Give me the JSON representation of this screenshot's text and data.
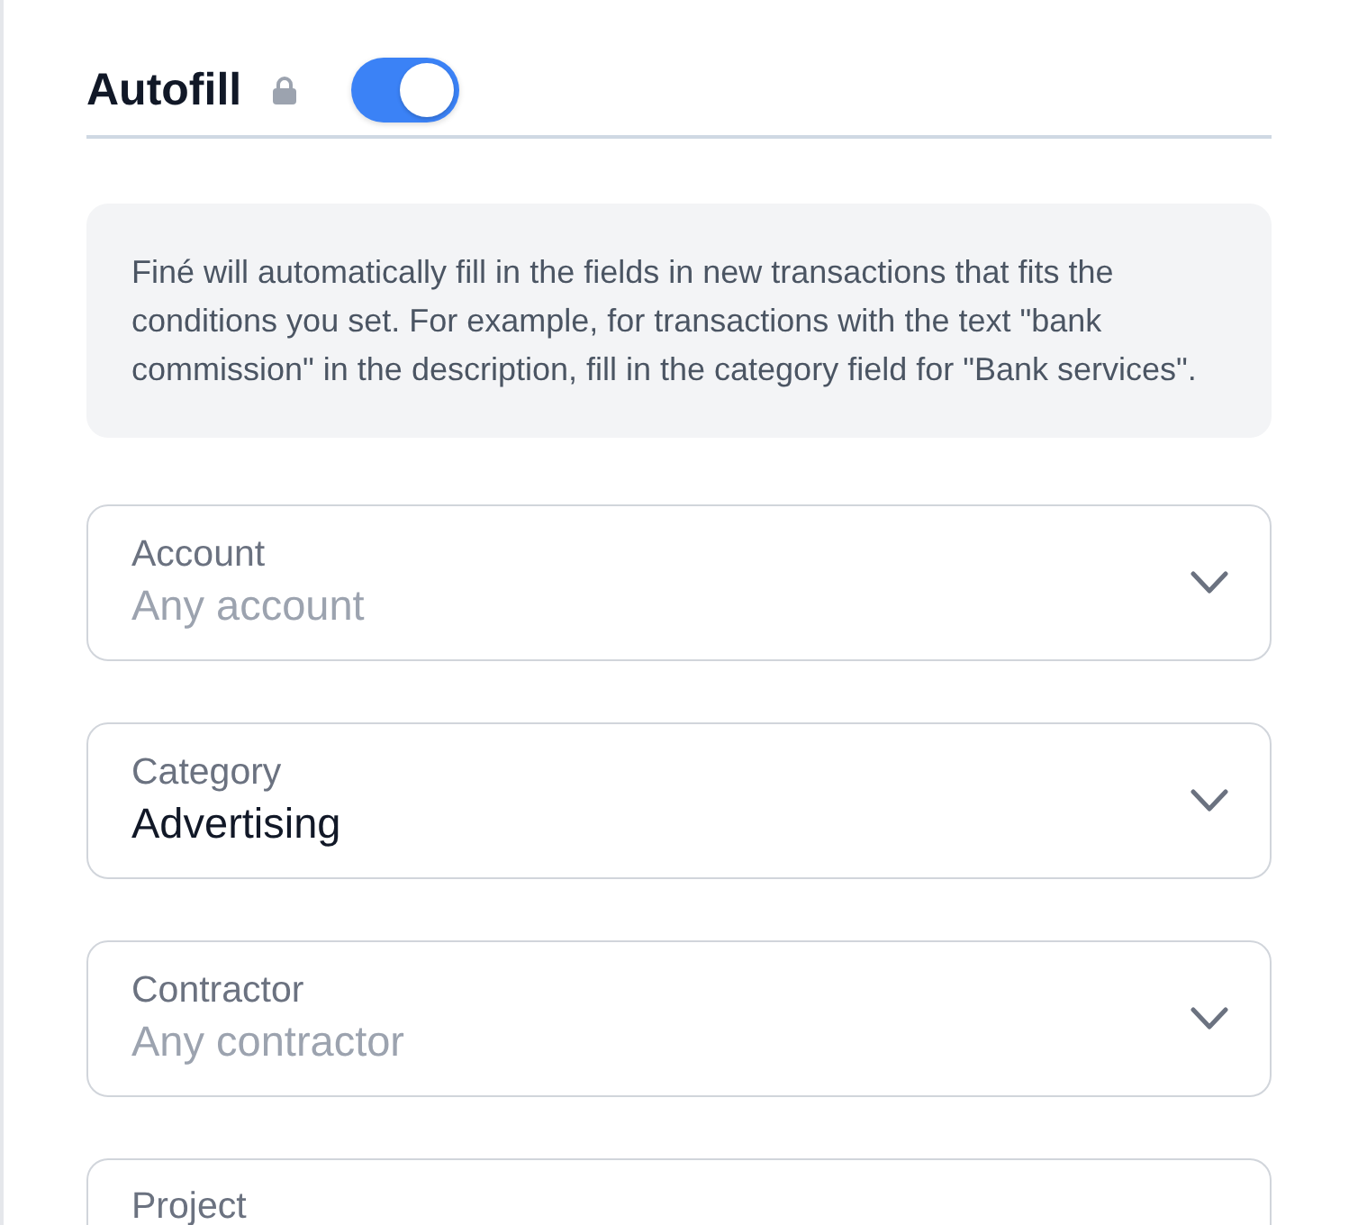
{
  "header": {
    "title": "Autofill",
    "toggle": {
      "on": true
    }
  },
  "info": {
    "text": "Finé will automatically fill in the fields in new transactions that fits the conditions you set. For example, for transactions with the text \"bank commission\" in the description, fill in the category field for \"Bank services\"."
  },
  "fields": [
    {
      "label": "Account",
      "placeholder": "Any account"
    },
    {
      "label": "Category",
      "value": "Advertising"
    },
    {
      "label": "Contractor",
      "placeholder": "Any contractor"
    },
    {
      "label": "Project"
    }
  ]
}
